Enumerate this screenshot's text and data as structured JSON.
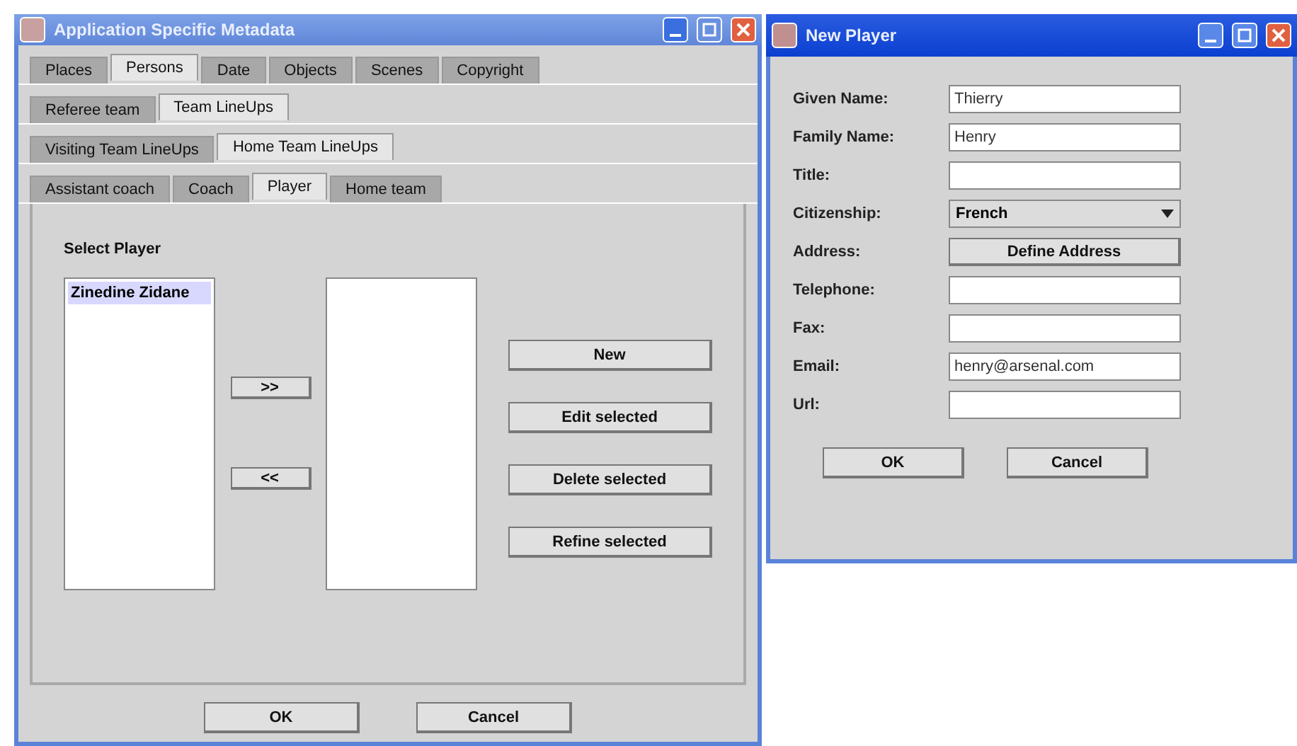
{
  "main_window": {
    "title": "Application Specific Metadata",
    "tabs": [
      {
        "label": "Places",
        "selected": false
      },
      {
        "label": "Persons",
        "selected": true
      },
      {
        "label": "Date",
        "selected": false
      },
      {
        "label": "Objects",
        "selected": false
      },
      {
        "label": "Scenes",
        "selected": false
      },
      {
        "label": "Copyright",
        "selected": false
      }
    ],
    "subtabs": [
      {
        "label": "Referee team",
        "selected": false
      },
      {
        "label": "Team LineUps",
        "selected": true
      }
    ],
    "team_tabs": [
      {
        "label": "Visiting Team LineUps",
        "selected": false
      },
      {
        "label": "Home Team LineUps",
        "selected": true
      }
    ],
    "role_tabs": [
      {
        "label": "Assistant coach",
        "selected": false
      },
      {
        "label": "Coach",
        "selected": false
      },
      {
        "label": "Player",
        "selected": true
      },
      {
        "label": "Home team",
        "selected": false
      }
    ],
    "select_label": "Select Player",
    "available_players": [
      {
        "name": "Zinedine Zidane",
        "selected": true
      }
    ],
    "move_buttons": [
      ">>",
      "<<"
    ],
    "action_buttons": [
      "New",
      "Edit selected",
      "Delete selected",
      "Refine selected"
    ],
    "buttons": [
      "OK",
      "Cancel"
    ]
  },
  "dialog": {
    "title": "New Player",
    "fields": [
      {
        "label": "Given Name:",
        "kind": "text",
        "value": "Thierry"
      },
      {
        "label": "Family Name:",
        "kind": "text",
        "value": "Henry"
      },
      {
        "label": "Title:",
        "kind": "text"
      },
      {
        "label": "Citizenship:",
        "kind": "select",
        "value": "French"
      },
      {
        "label": "Address:",
        "kind": "button",
        "value": "Define Address"
      },
      {
        "label": "Telephone:",
        "kind": "text"
      },
      {
        "label": "Fax:",
        "kind": "text"
      },
      {
        "label": "Email:",
        "kind": "text",
        "value": "henry@arsenal.com"
      },
      {
        "label": "Url:",
        "kind": "text"
      }
    ],
    "buttons": [
      "OK",
      "Cancel"
    ]
  }
}
